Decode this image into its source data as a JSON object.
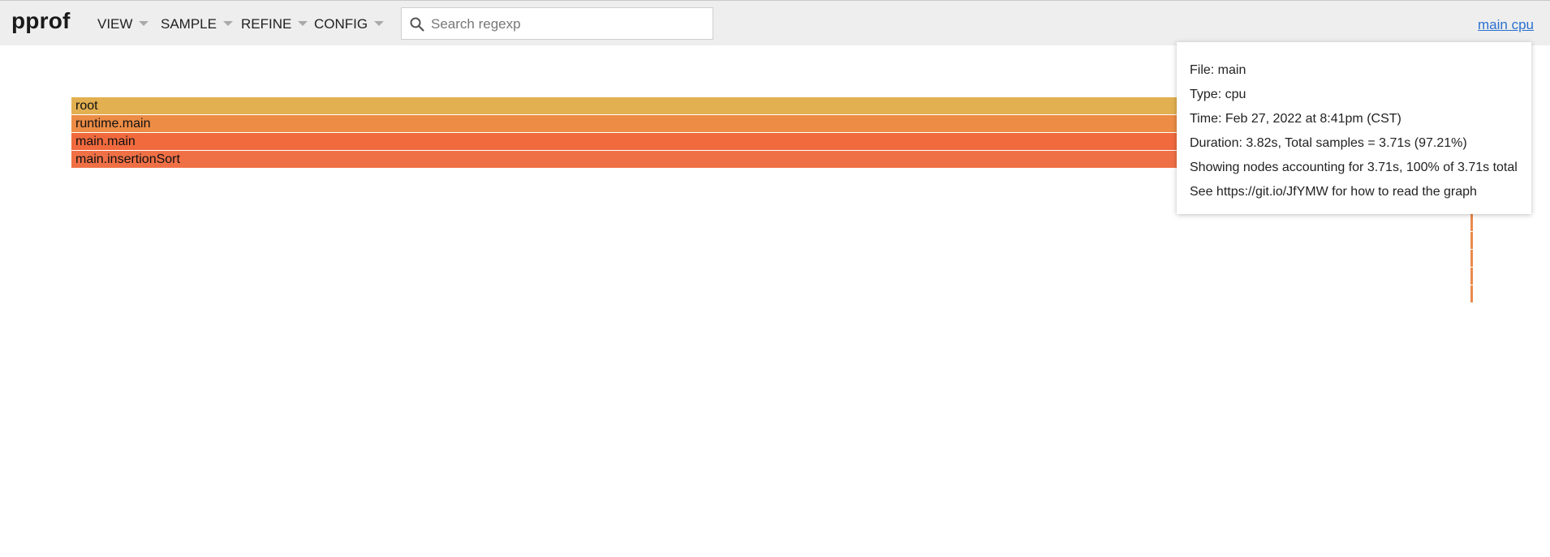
{
  "header": {
    "title": "pprof",
    "menus": [
      {
        "label": "VIEW"
      },
      {
        "label": "SAMPLE"
      },
      {
        "label": "REFINE"
      },
      {
        "label": "CONFIG"
      }
    ],
    "search": {
      "placeholder": "Search regexp",
      "value": ""
    },
    "profile_link": "main cpu"
  },
  "flamegraph": {
    "frames": [
      {
        "label": "root",
        "color": "#e2b050"
      },
      {
        "label": "runtime.main",
        "color": "#ec8c45"
      },
      {
        "label": "main.main",
        "color": "#f06a3e"
      },
      {
        "label": "main.insertionSort",
        "color": "#f07046"
      }
    ]
  },
  "tooltip": {
    "lines": [
      "File: main",
      "Type: cpu",
      "Time: Feb 27, 2022 at 8:41pm (CST)",
      "Duration: 3.82s, Total samples = 3.71s (97.21%)",
      "Showing nodes accounting for 3.71s, 100% of 3.71s total",
      "See https://git.io/JfYMW for how to read the graph"
    ]
  },
  "colors": {
    "header_bg": "#eeeeee",
    "link": "#2a6fd0",
    "tick": "#ea8a4c"
  },
  "icons": {
    "search": "search-icon",
    "dropdown": "chevron-down-icon"
  }
}
